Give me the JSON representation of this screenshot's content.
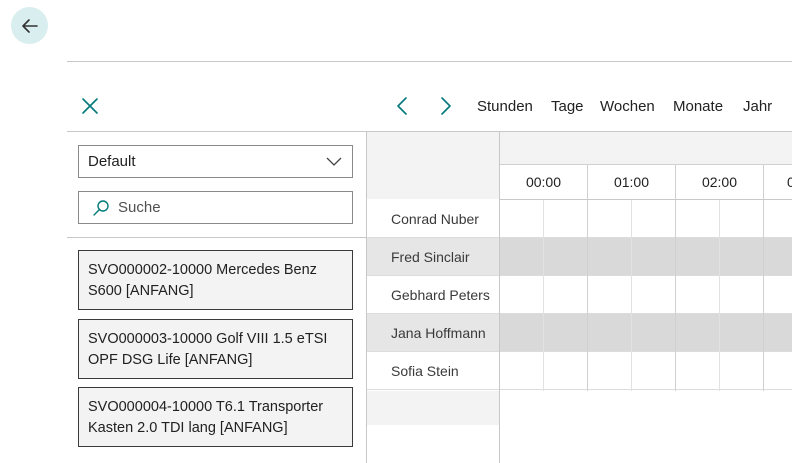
{
  "navigation": {
    "back_icon": "arrow-left-icon"
  },
  "toolbar": {
    "close_icon": "close-icon",
    "prev_icon": "chevron-left-icon",
    "next_icon": "chevron-right-icon",
    "views": [
      "Stunden",
      "Tage",
      "Wochen",
      "Monate",
      "Jahr"
    ]
  },
  "filter": {
    "selected": "Default",
    "icon": "chevron-down-icon"
  },
  "search": {
    "placeholder": "Suche",
    "icon": "search-icon"
  },
  "orders": [
    "SVO000002-10000 Mercedes Benz S600 [ANFANG]",
    "SVO000003-10000 Golf VIII 1.5 eTSI OPF DSG Life [ANFANG]",
    "SVO000004-10000 T6.1 Transporter Kasten 2.0 TDI lang [ANFANG]"
  ],
  "timeline": {
    "hours": [
      "00:00",
      "01:00",
      "02:00",
      "0"
    ]
  },
  "resources": [
    "Conrad Nuber",
    "Fred Sinclair",
    "Gebhard Peters",
    "Jana Hoffmann",
    "Sofia Stein"
  ],
  "colors": {
    "accent": "#00797a",
    "back_button_bg": "#d9eeee",
    "alt_row": "#d9d9d9",
    "header_bg": "#f3f3f3"
  }
}
